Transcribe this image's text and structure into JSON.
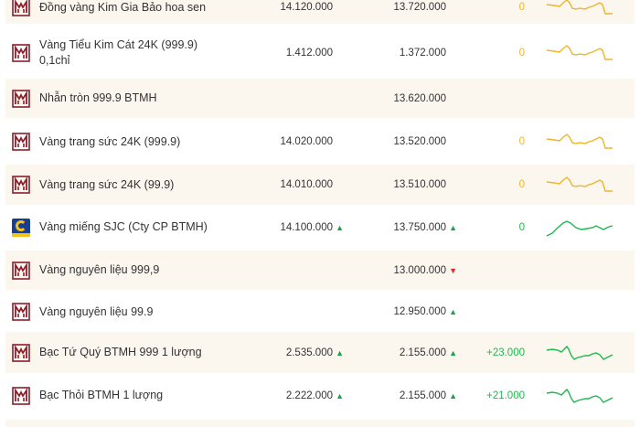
{
  "rows": [
    {
      "name": "Đồng vàng Kim Gia Bảo hoa sen",
      "buy": "14.120.000",
      "buy_dir": "",
      "sell": "13.720.000",
      "sell_dir": "",
      "change": "0",
      "change_color": "#f0b429",
      "spark": "gold",
      "logo": "btmh-logo-icon"
    },
    {
      "name": "Vàng Tiểu Kim Cát 24K (999.9) 0,1chỉ",
      "buy": "1.412.000",
      "buy_dir": "",
      "sell": "1.372.000",
      "sell_dir": "",
      "change": "0",
      "change_color": "#f0b429",
      "spark": "gold",
      "logo": "btmh-logo-icon"
    },
    {
      "name": "Nhẫn tròn 999.9 BTMH",
      "buy": "",
      "buy_dir": "",
      "sell": "13.620.000",
      "sell_dir": "",
      "change": "",
      "change_color": "",
      "spark": "none",
      "logo": "btmh-logo-icon"
    },
    {
      "name": "Vàng trang sức 24K (999.9)",
      "buy": "14.020.000",
      "buy_dir": "",
      "sell": "13.520.000",
      "sell_dir": "",
      "change": "0",
      "change_color": "#f0b429",
      "spark": "gold",
      "logo": "btmh-logo-icon"
    },
    {
      "name": "Vàng trang sức 24K (99.9)",
      "buy": "14.010.000",
      "buy_dir": "",
      "sell": "13.510.000",
      "sell_dir": "",
      "change": "0",
      "change_color": "#f0b429",
      "spark": "gold",
      "logo": "btmh-logo-icon"
    },
    {
      "name": "Vàng miếng SJC (Cty CP BTMH)",
      "buy": "14.100.000",
      "buy_dir": "up",
      "sell": "13.750.000",
      "sell_dir": "up",
      "change": "0",
      "change_color": "#1fb84e",
      "spark": "green-hump",
      "logo": "sjc-logo-icon"
    },
    {
      "name": "Vàng nguyên liệu 999,9",
      "buy": "",
      "buy_dir": "",
      "sell": "13.000.000",
      "sell_dir": "down",
      "change": "",
      "change_color": "",
      "spark": "none",
      "logo": "btmh-logo-icon"
    },
    {
      "name": "Vàng nguyên liệu 99.9",
      "buy": "",
      "buy_dir": "",
      "sell": "12.950.000",
      "sell_dir": "up",
      "change": "",
      "change_color": "",
      "spark": "none",
      "logo": "btmh-logo-icon"
    },
    {
      "name": "Bạc Tứ Quý BTMH 999 1 lượng",
      "buy": "2.535.000",
      "buy_dir": "up",
      "sell": "2.155.000",
      "sell_dir": "up",
      "change": "+23.000",
      "change_color": "#1fb84e",
      "spark": "green-wave",
      "logo": "btmh-logo-icon"
    },
    {
      "name": "Bạc Thỏi BTMH 1 lượng",
      "buy": "2.222.000",
      "buy_dir": "up",
      "sell": "2.155.000",
      "sell_dir": "up",
      "change": "+21.000",
      "change_color": "#1fb84e",
      "spark": "green-wave",
      "logo": "btmh-logo-icon"
    }
  ],
  "arrows": {
    "up": "▲",
    "down": "▼"
  },
  "colors": {
    "row_shade": "#fbf6ee",
    "brand_maroon": "#8b1e2b",
    "gold_line": "#f0b429",
    "green_line": "#1fb84e",
    "up": "#1aa34a",
    "down": "#e0282e"
  }
}
